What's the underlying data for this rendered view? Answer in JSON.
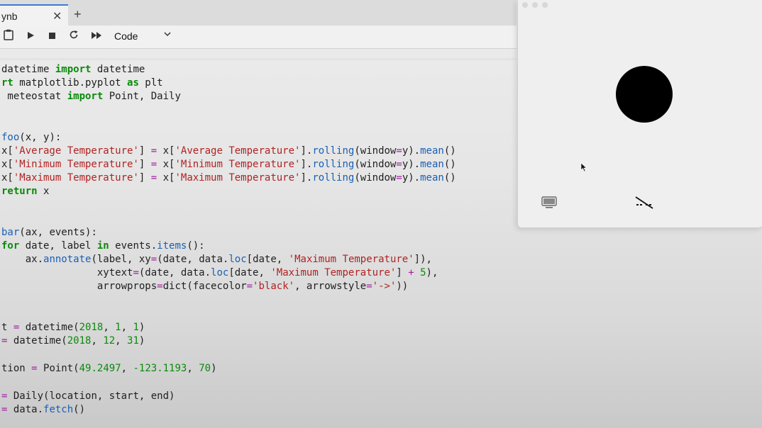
{
  "tab": {
    "label": "ynb",
    "close": "✕",
    "add": "+"
  },
  "toolbar": {
    "cell_type": "Code",
    "chevron": "⌄"
  },
  "code": {
    "line1": [
      "datetime ",
      "import",
      " datetime"
    ],
    "line2": [
      "rt",
      " matplotlib.pyplot ",
      "as",
      " plt"
    ],
    "line3": [
      " meteostat ",
      "import",
      " Point, Daily"
    ],
    "line5": [
      "foo",
      "(x, y):"
    ],
    "line6": [
      "x[",
      "'Average Temperature'",
      "] ",
      "=",
      " x[",
      "'Average Temperature'",
      "].",
      "rolling",
      "(window",
      "=",
      "y).",
      "mean",
      "()"
    ],
    "line7": [
      "x[",
      "'Minimum Temperature'",
      "] ",
      "=",
      " x[",
      "'Minimum Temperature'",
      "].",
      "rolling",
      "(window",
      "=",
      "y).",
      "mean",
      "()"
    ],
    "line8": [
      "x[",
      "'Maximum Temperature'",
      "] ",
      "=",
      " x[",
      "'Maximum Temperature'",
      "].",
      "rolling",
      "(window",
      "=",
      "y).",
      "mean",
      "()"
    ],
    "line9": [
      "return",
      " x"
    ],
    "line11": [
      "bar",
      "(ax, events):"
    ],
    "line12": [
      "for",
      " date, label ",
      "in",
      " events.",
      "items",
      "():"
    ],
    "line13": [
      "    ax.",
      "annotate",
      "(label, xy",
      "=",
      "(date, data.",
      "loc",
      "[date, ",
      "'Maximum Temperature'",
      "]),"
    ],
    "line14": [
      "                xytext",
      "=",
      "(date, data.",
      "loc",
      "[date, ",
      "'Maximum Temperature'",
      "] ",
      "+",
      " ",
      "5",
      "),"
    ],
    "line15": [
      "                arrowprops",
      "=",
      "dict",
      "(facecolor",
      "=",
      "'black'",
      ", arrowstyle",
      "=",
      "'->'",
      "))"
    ],
    "line17": [
      "t ",
      "=",
      " datetime(",
      "2018",
      ", ",
      "1",
      ", ",
      "1",
      ")"
    ],
    "line18": [
      "=",
      " datetime(",
      "2018",
      ", ",
      "12",
      ", ",
      "31",
      ")"
    ],
    "line20": [
      "tion ",
      "=",
      " Point(",
      "49.2497",
      ", ",
      "-123.1193",
      ", ",
      "70",
      ")"
    ],
    "line22": [
      "=",
      " Daily(location, start, end)"
    ],
    "line23": [
      "=",
      " data.",
      "fetch",
      "()"
    ]
  },
  "icons": {
    "save": "clipboard-icon",
    "run": "play-icon",
    "stop": "stop-icon",
    "restart": "restart-icon",
    "run_all": "fast-forward-icon",
    "monitor": "monitor-icon",
    "captions_off": "captions-off-icon"
  },
  "colors": {
    "keyword": "#0a8a0a",
    "function": "#1a5fb4",
    "string": "#b22222",
    "operator": "#a020a0",
    "tab_accent": "#3a7bd5"
  }
}
